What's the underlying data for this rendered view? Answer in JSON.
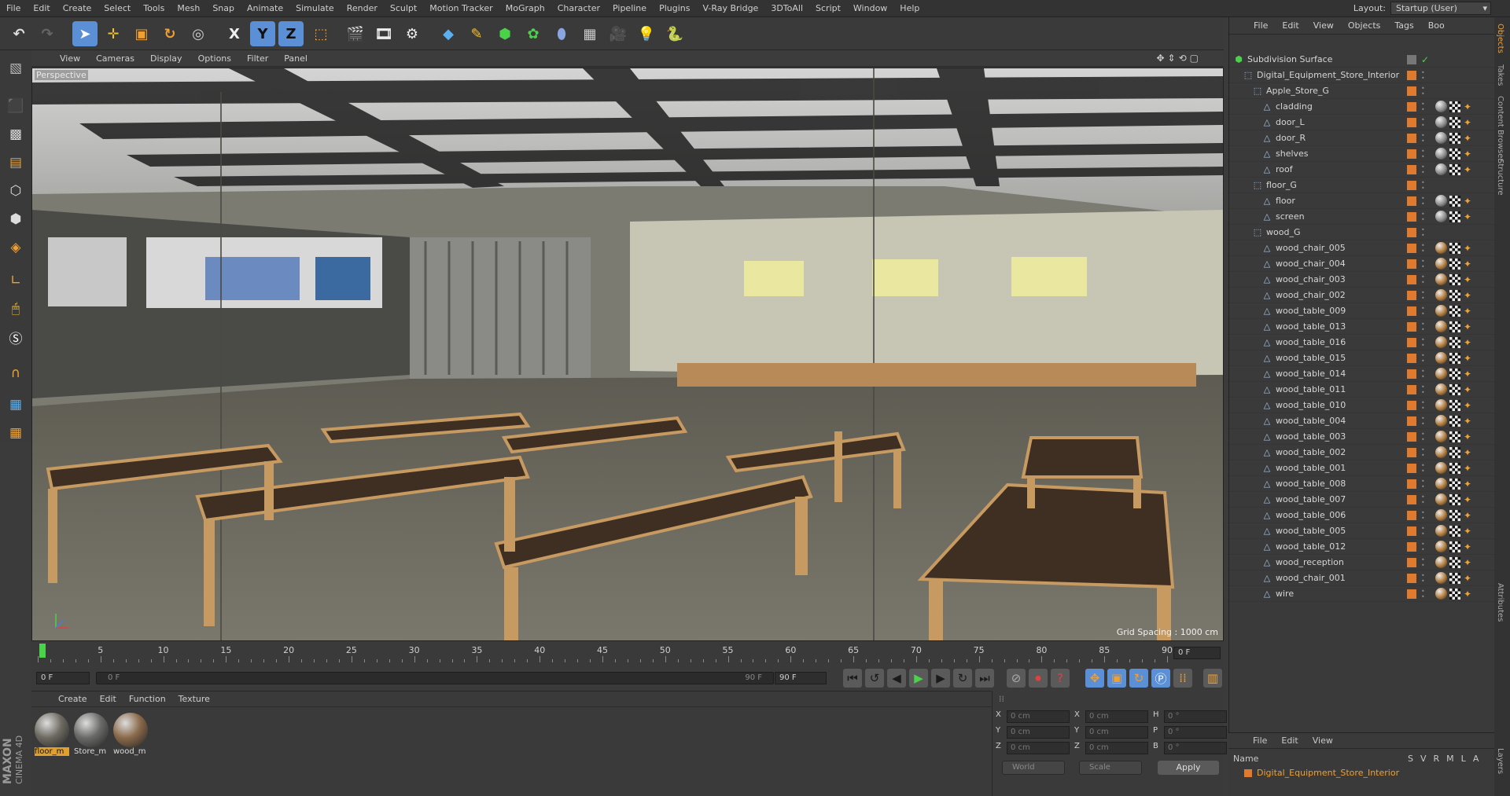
{
  "menubar": {
    "items": [
      "File",
      "Edit",
      "Create",
      "Select",
      "Tools",
      "Mesh",
      "Snap",
      "Animate",
      "Simulate",
      "Render",
      "Sculpt",
      "Motion Tracker",
      "MoGraph",
      "Character",
      "Pipeline",
      "Plugins",
      "V-Ray Bridge",
      "3DToAll",
      "Script",
      "Window",
      "Help"
    ],
    "layout_label": "Layout:",
    "layout_value": "Startup (User)"
  },
  "toolbar": {
    "axis_x": "X",
    "axis_y": "Y",
    "axis_z": "Z"
  },
  "viewport": {
    "menu": [
      "View",
      "Cameras",
      "Display",
      "Options",
      "Filter",
      "Panel"
    ],
    "label": "Perspective",
    "grid_spacing": "Grid Spacing : 1000 cm"
  },
  "timeline": {
    "ticks": [
      "5",
      "10",
      "15",
      "20",
      "25",
      "30",
      "35",
      "40",
      "45",
      "50",
      "55",
      "60",
      "65",
      "70",
      "75",
      "80",
      "85",
      "90"
    ],
    "current_frame_right": "0 F",
    "start_frame": "0 F",
    "slider_start": "0 F",
    "slider_end": "90 F",
    "end_frame": "90 F"
  },
  "materials": {
    "menu": [
      "Create",
      "Edit",
      "Function",
      "Texture"
    ],
    "items": [
      {
        "label": "floor_m",
        "color": "#6e6a62",
        "selected": true
      },
      {
        "label": "Store_m",
        "color": "#6a6a68",
        "selected": false
      },
      {
        "label": "wood_m",
        "color": "#8a6a4a",
        "selected": false
      }
    ]
  },
  "coords": {
    "rows": [
      {
        "a": "X",
        "av": "0 cm",
        "b": "X",
        "bv": "0 cm",
        "c": "H",
        "cv": "0 °"
      },
      {
        "a": "Y",
        "av": "0 cm",
        "b": "Y",
        "bv": "0 cm",
        "c": "P",
        "cv": "0 °"
      },
      {
        "a": "Z",
        "av": "0 cm",
        "b": "Z",
        "bv": "0 cm",
        "c": "B",
        "cv": "0 °"
      }
    ],
    "mode": "World",
    "scale": "Scale",
    "apply": "Apply"
  },
  "objects": {
    "menu": [
      "File",
      "Edit",
      "View",
      "Objects",
      "Tags",
      "Boo"
    ],
    "rows": [
      {
        "name": "Subdivision Surface",
        "indent": 0,
        "type": "sub"
      },
      {
        "name": "Digital_Equipment_Store_Interior",
        "indent": 1,
        "type": "null"
      },
      {
        "name": "Apple_Store_G",
        "indent": 2,
        "type": "null"
      },
      {
        "name": "cladding",
        "indent": 3,
        "type": "mesh"
      },
      {
        "name": "door_L",
        "indent": 3,
        "type": "mesh"
      },
      {
        "name": "door_R",
        "indent": 3,
        "type": "mesh"
      },
      {
        "name": "shelves",
        "indent": 3,
        "type": "mesh"
      },
      {
        "name": "roof",
        "indent": 3,
        "type": "mesh"
      },
      {
        "name": "floor_G",
        "indent": 2,
        "type": "null"
      },
      {
        "name": "floor",
        "indent": 3,
        "type": "mesh"
      },
      {
        "name": "screen",
        "indent": 3,
        "type": "mesh"
      },
      {
        "name": "wood_G",
        "indent": 2,
        "type": "null"
      },
      {
        "name": "wood_chair_005",
        "indent": 3,
        "type": "mesh"
      },
      {
        "name": "wood_chair_004",
        "indent": 3,
        "type": "mesh"
      },
      {
        "name": "wood_chair_003",
        "indent": 3,
        "type": "mesh"
      },
      {
        "name": "wood_chair_002",
        "indent": 3,
        "type": "mesh"
      },
      {
        "name": "wood_table_009",
        "indent": 3,
        "type": "mesh"
      },
      {
        "name": "wood_table_013",
        "indent": 3,
        "type": "mesh"
      },
      {
        "name": "wood_table_016",
        "indent": 3,
        "type": "mesh"
      },
      {
        "name": "wood_table_015",
        "indent": 3,
        "type": "mesh"
      },
      {
        "name": "wood_table_014",
        "indent": 3,
        "type": "mesh"
      },
      {
        "name": "wood_table_011",
        "indent": 3,
        "type": "mesh"
      },
      {
        "name": "wood_table_010",
        "indent": 3,
        "type": "mesh"
      },
      {
        "name": "wood_table_004",
        "indent": 3,
        "type": "mesh"
      },
      {
        "name": "wood_table_003",
        "indent": 3,
        "type": "mesh"
      },
      {
        "name": "wood_table_002",
        "indent": 3,
        "type": "mesh"
      },
      {
        "name": "wood_table_001",
        "indent": 3,
        "type": "mesh"
      },
      {
        "name": "wood_table_008",
        "indent": 3,
        "type": "mesh"
      },
      {
        "name": "wood_table_007",
        "indent": 3,
        "type": "mesh"
      },
      {
        "name": "wood_table_006",
        "indent": 3,
        "type": "mesh"
      },
      {
        "name": "wood_table_005",
        "indent": 3,
        "type": "mesh"
      },
      {
        "name": "wood_table_012",
        "indent": 3,
        "type": "mesh"
      },
      {
        "name": "wood_reception",
        "indent": 3,
        "type": "mesh"
      },
      {
        "name": "wood_chair_001",
        "indent": 3,
        "type": "mesh"
      },
      {
        "name": "wire",
        "indent": 3,
        "type": "mesh"
      }
    ]
  },
  "sidetabs": [
    "Objects",
    "Takes",
    "Content Browser",
    "Structure",
    "Attributes",
    "Layers"
  ],
  "layers": {
    "menu": [
      "File",
      "Edit",
      "View"
    ],
    "header_name": "Name",
    "header_cols": [
      "S",
      "V",
      "R",
      "M",
      "L",
      "A"
    ],
    "row": "Digital_Equipment_Store_Interior"
  },
  "colors": {
    "layer_orange": "#e07a2e",
    "accent_blue": "#5b8fd6",
    "play_green": "#4bd24b"
  }
}
